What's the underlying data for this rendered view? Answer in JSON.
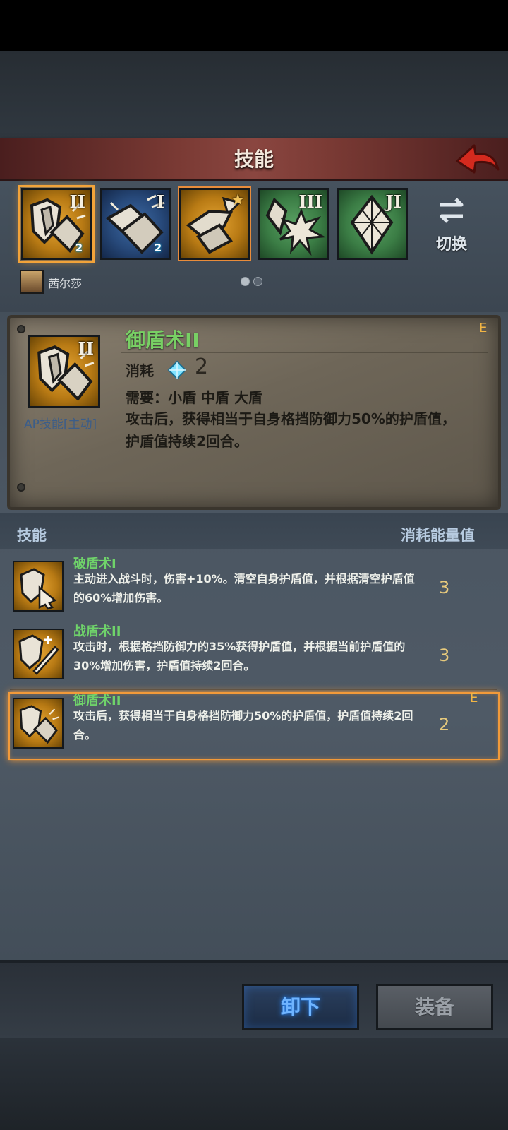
{
  "header": {
    "title": "技能"
  },
  "slots": [
    {
      "roman": "II",
      "gem": "2",
      "star": ""
    },
    {
      "roman": "I",
      "gem": "2",
      "star": ""
    },
    {
      "roman": "",
      "gem": "",
      "star": "★"
    },
    {
      "roman": "III",
      "gem": "",
      "star": ""
    },
    {
      "roman": "JI",
      "gem": "",
      "star": ""
    }
  ],
  "switch_label": "切换",
  "character": {
    "name": "茜尔莎"
  },
  "detail": {
    "roman": "II",
    "name": "御盾术II",
    "rank": "E",
    "cost_label": "消耗",
    "cost_value": "2",
    "requirement": "需要：小盾 中盾 大盾",
    "description": "攻击后，获得相当于自身格挡防御力50%的护盾值，护盾值持续2回合。",
    "type": "AP技能[主动]"
  },
  "list": {
    "header_left": "技能",
    "header_right": "消耗能量值",
    "items": [
      {
        "name": "破盾术I",
        "desc": "主动进入战斗时，伤害+10%。清空自身护盾值，并根据清空护盾值的60%增加伤害。",
        "cost": "3",
        "rank": ""
      },
      {
        "name": "战盾术II",
        "desc": "攻击时，根据格挡防御力的35%获得护盾值，并根据当前护盾值的30%增加伤害，护盾值持续2回合。",
        "cost": "3",
        "rank": ""
      },
      {
        "name": "御盾术II",
        "desc": "攻击后，获得相当于自身格挡防御力50%的护盾值，护盾值持续2回合。",
        "cost": "2",
        "rank": "E"
      }
    ]
  },
  "buttons": {
    "unequip": "卸下",
    "equip": "装备"
  }
}
